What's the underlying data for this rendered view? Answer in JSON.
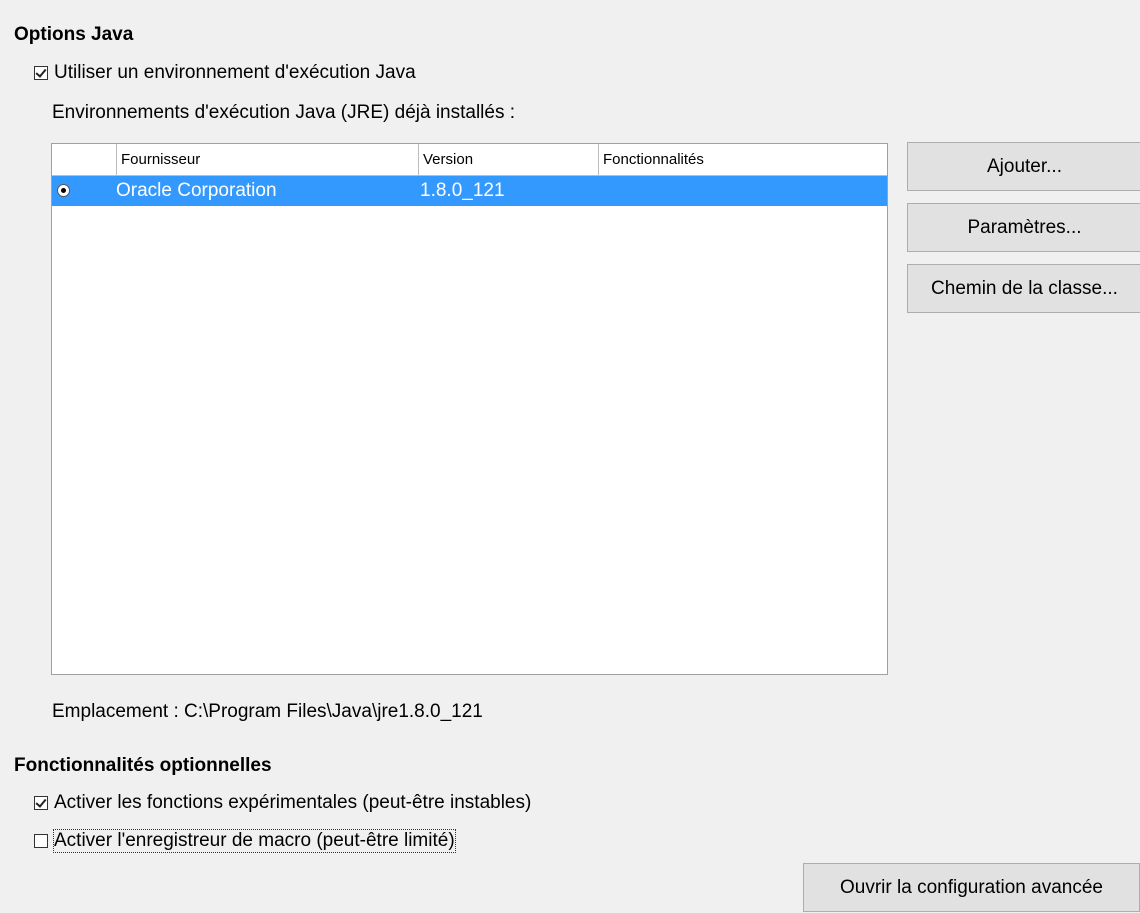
{
  "java_options": {
    "title": "Options Java",
    "use_jre_label": "Utiliser un environnement d'exécution Java",
    "use_jre_checked": true,
    "installed_label": "Environnements d'exécution Java (JRE) déjà installés :",
    "table": {
      "columns": [
        "",
        "Fournisseur",
        "Version",
        "Fonctionnalités"
      ],
      "rows": [
        {
          "selected": true,
          "vendor": "Oracle Corporation",
          "version": "1.8.0_121",
          "features": ""
        }
      ]
    },
    "buttons": {
      "add": "Ajouter...",
      "parameters": "Paramètres...",
      "classpath": "Chemin de la classe..."
    },
    "location_label": "Emplacement : C:\\Program Files\\Java\\jre1.8.0_121"
  },
  "optional_features": {
    "title": "Fonctionnalités optionnelles",
    "experimental_label": "Activer les fonctions expérimentales (peut-être instables)",
    "experimental_checked": true,
    "macro_recorder_label": "Activer l'enregistreur de macro (peut-être limité)",
    "macro_recorder_checked": false,
    "expert_config_button": "Ouvrir la configuration avancée"
  },
  "colors": {
    "selection": "#3399ff",
    "background": "#f0f0f0",
    "button_face": "#e1e1e1"
  }
}
